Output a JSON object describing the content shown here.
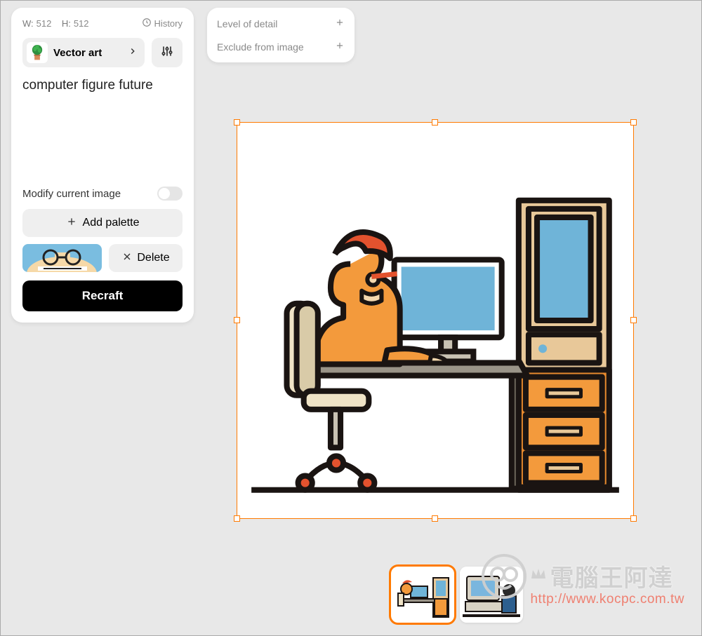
{
  "panel": {
    "width_label": "W:",
    "width_value": "512",
    "height_label": "H:",
    "height_value": "512",
    "history_label": "History",
    "style_name": "Vector art",
    "prompt": "computer figure future",
    "modify_label": "Modify current image",
    "add_palette_label": "Add palette",
    "delete_label": "Delete",
    "recraft_label": "Recraft"
  },
  "advanced": {
    "level_of_detail": "Level of detail",
    "exclude": "Exclude from image"
  },
  "watermark": {
    "line1": "電腦王阿達",
    "line2": "http://www.kocpc.com.tw"
  }
}
